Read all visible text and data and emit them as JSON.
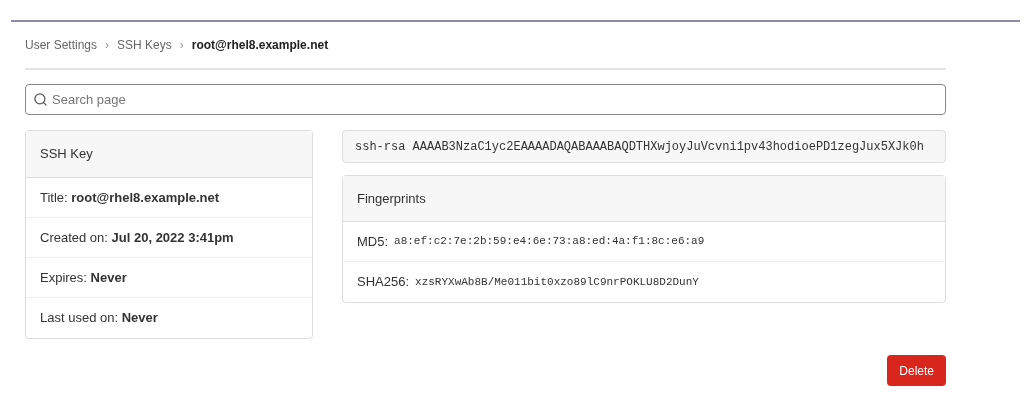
{
  "breadcrumb": [
    {
      "label": "User Settings",
      "current": false
    },
    {
      "label": "SSH Keys",
      "current": false
    },
    {
      "label": "root@rhel8.example.net",
      "current": true
    }
  ],
  "breadcrumb_separator": "›",
  "search": {
    "placeholder": "Search page"
  },
  "details": {
    "title": "SSH Key",
    "rows": [
      "Title: **root@rhel8.example.net**",
      "Created on: **Jul 20, 2022 3:41pm**",
      "Expires: **Never**",
      "Last used on: **Never**"
    ]
  },
  "key": "ssh-rsa AAAAB3NzaC1yc2EAAAADAQABAAABAQDTHXwjoyJuVcvni1pv43hodioePD1zegJux5XJk0h",
  "fingerprints": {
    "title": "Fingerprints",
    "rows": [
      {
        "label": "MD5:",
        "value": "a8:ef:c2:7e:2b:59:e4:6e:73:a8:ed:4a:f1:8c:e6:a9"
      },
      {
        "label": "SHA256:",
        "value": "xzsRYXwAb8B/Me011bit0xzo89lC9nrPOKLU8D2DunY"
      }
    ]
  },
  "delete_button": "Delete"
}
